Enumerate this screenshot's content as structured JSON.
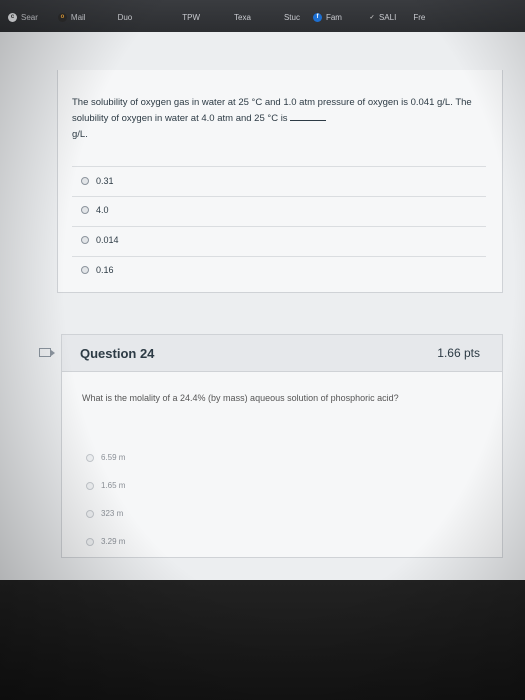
{
  "tabs": [
    {
      "icon": "c",
      "icon_name": "chrome-icon",
      "label": "Sear"
    },
    {
      "icon": "o",
      "icon_name": "outlook-icon",
      "label": "Mail"
    },
    {
      "icon": "",
      "icon_name": "",
      "label": "Duo"
    },
    {
      "icon": "",
      "icon_name": "",
      "label": "TPW"
    },
    {
      "icon": "",
      "icon_name": "",
      "label": "Texa"
    },
    {
      "icon": "",
      "icon_name": "",
      "label": "Stuc"
    },
    {
      "icon": "f",
      "icon_name": "fam-icon",
      "label": "Fam"
    },
    {
      "icon": "v",
      "icon_name": "checkmark-icon",
      "label": "SALI"
    },
    {
      "icon": "",
      "icon_name": "",
      "label": "Fre"
    }
  ],
  "question_prev": {
    "prompt_part1": "The solubility of oxygen gas in water at 25 °C and 1.0 atm pressure of oxygen is 0.041 g/L. The solubility of oxygen in water at 4.0 atm and 25 °C is",
    "prompt_part2": "g/L.",
    "options": [
      "0.31",
      "4.0",
      "0.014",
      "0.16"
    ]
  },
  "question_24": {
    "title": "Question 24",
    "points": "1.66 pts",
    "prompt": "What is the molality of a 24.4% (by mass) aqueous solution of phosphoric acid?",
    "options": [
      "6.59 m",
      "1.65 m",
      "323 m",
      "3.29 m"
    ]
  },
  "colors": {
    "accent": "#2d3b45",
    "page_bg": "#eceef0",
    "tab_bg": "#2c2e31"
  }
}
